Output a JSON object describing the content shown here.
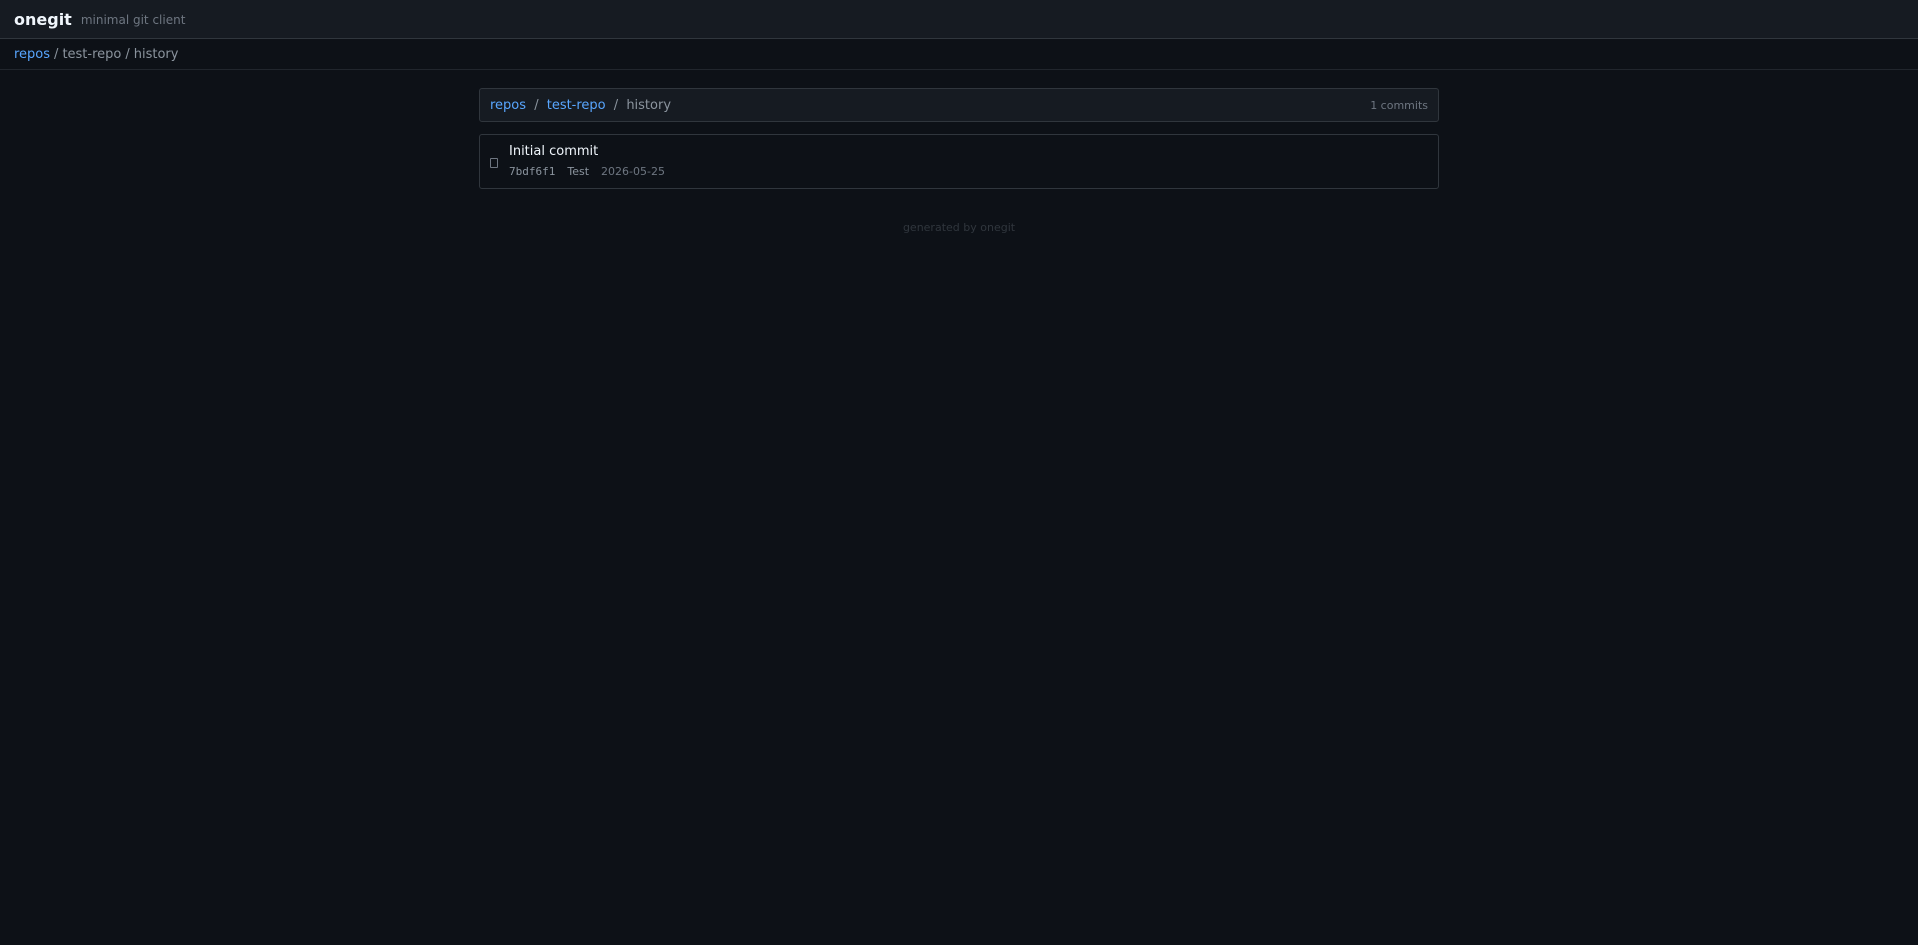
{
  "app": {
    "name": "onegit",
    "tagline": "minimal git client"
  },
  "nav": {
    "repos": "repos",
    "sep": "/",
    "repo": "test-repo",
    "page": "history"
  },
  "panel": {
    "repos": "repos",
    "repo": "test-repo",
    "page": "history",
    "count": "1 commits"
  },
  "commits": [
    {
      "message": "Initial commit",
      "sha": "7bdf6f1",
      "author": "Test",
      "date": "2026-05-25"
    }
  ],
  "footer": {
    "text": "generated by onegit"
  },
  "colors": {
    "background": "#0d1117",
    "link": "#58a6ff",
    "border": "#30363d"
  }
}
